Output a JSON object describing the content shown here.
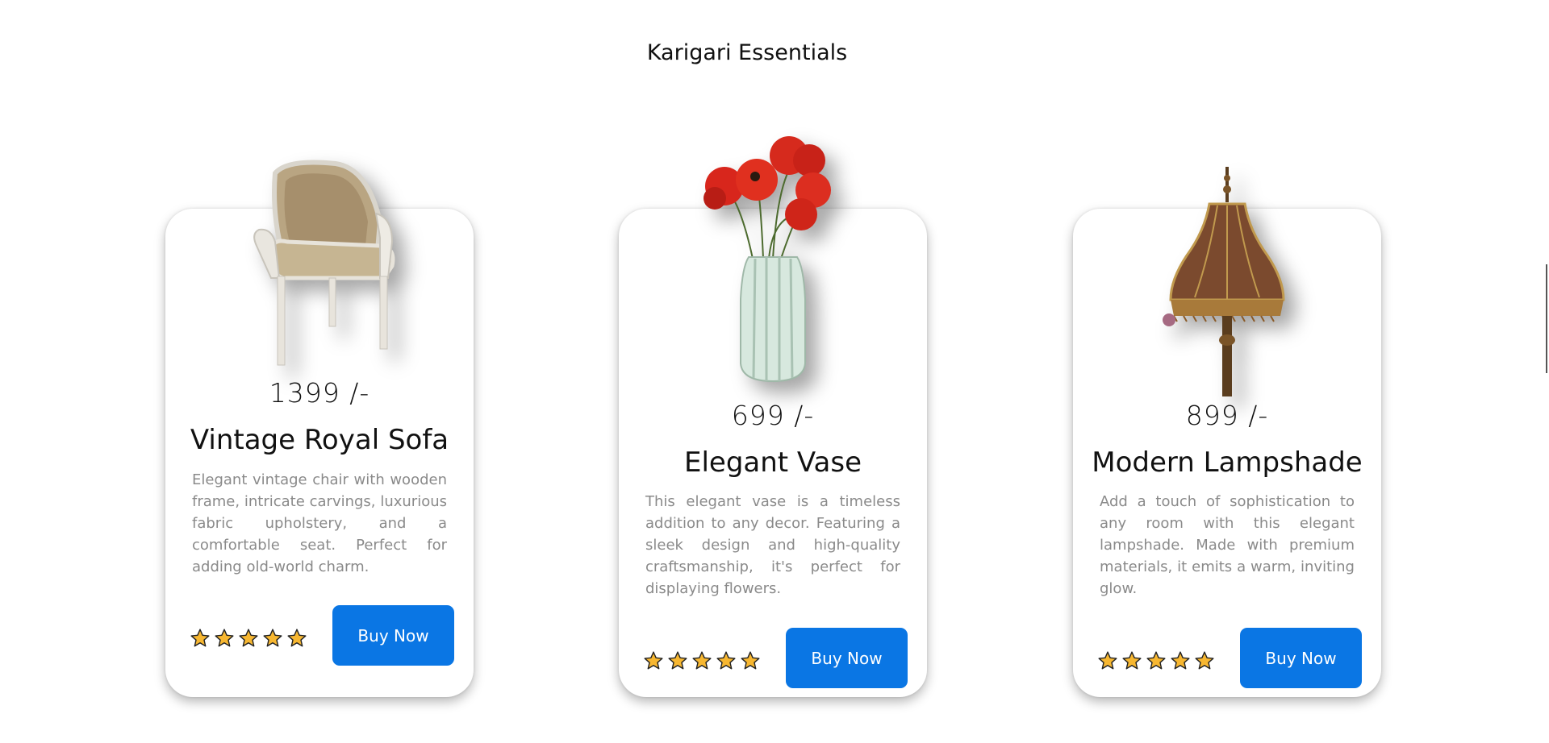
{
  "section": {
    "title": "Karigari Essentials"
  },
  "cards": [
    {
      "price": "1399 /-",
      "name": "Vintage Royal Sofa",
      "description": "Elegant vintage chair with wooden frame, intricate carvings, luxurious fabric upholstery, and a comfortable seat. Perfect for adding old-world charm.",
      "rating": 5,
      "button": "Buy Now",
      "image_icon": "armchair-icon"
    },
    {
      "price": "699 /-",
      "name": "Elegant Vase",
      "description": "This elegant vase is a timeless addition to any decor. Featuring a sleek design and high-quality craftsmanship, it's perfect for displaying flowers.",
      "rating": 5,
      "button": "Buy Now",
      "image_icon": "flower-vase-icon"
    },
    {
      "price": "899 /-",
      "name": "Modern Lampshade",
      "description": "Add a touch of sophistication to any room with this elegant lampshade. Made with premium materials, it emits a warm, inviting glow.",
      "rating": 5,
      "button": "Buy Now",
      "image_icon": "lampshade-icon"
    }
  ],
  "colors": {
    "accent": "#0a76e4",
    "star_fill": "#f7b731",
    "star_stroke": "#222222",
    "description_text": "#8a8a8a"
  }
}
